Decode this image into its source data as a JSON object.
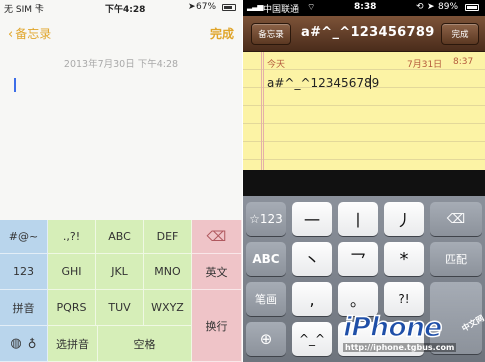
{
  "left": {
    "status": {
      "carrier": "无 SIM 卡",
      "time": "下午4:28",
      "battery": "67%"
    },
    "nav": {
      "back_label": "备忘录",
      "done_label": "完成"
    },
    "note": {
      "date": "2013年7月30日 下午4:28",
      "text": ""
    },
    "keyboard": {
      "col1": [
        "#@~",
        "123",
        "拼音"
      ],
      "col2": [
        ".,?!",
        "GHI",
        "PQRS"
      ],
      "col3": [
        "ABC",
        "JKL",
        "TUV"
      ],
      "col4": [
        "DEF",
        "MNO",
        "WXYZ"
      ],
      "col5": [
        "⌫",
        "英文",
        "换行"
      ],
      "bottom": {
        "select_pinyin": "选拼音",
        "space": "空格"
      }
    },
    "colors": {
      "accent": "#e0a52a",
      "key_blue": "#b9d5ec",
      "key_green": "#d6eeb8",
      "key_red": "#efc4c8"
    }
  },
  "right": {
    "status": {
      "carrier": "中国联通",
      "time": "8:38",
      "battery": "89%"
    },
    "nav": {
      "back_label": "备忘录",
      "title": "a#^_^123456789",
      "done_label": "完成"
    },
    "note": {
      "today": "今天",
      "date": "7月31日",
      "time": "8:37",
      "text": "a#^_^123456789"
    },
    "keyboard": {
      "row1": [
        "☆123",
        "一",
        "丨",
        "丿",
        "⌫"
      ],
      "row2": [
        "ABC",
        "丶",
        "乛",
        "*",
        "匹配"
      ],
      "row3": [
        "笔画",
        ",",
        "。",
        "?!",
        ""
      ],
      "row4": [
        "⊕",
        "^_^",
        "",
        "",
        ""
      ]
    }
  },
  "watermark": {
    "brand": "iPhone",
    "url": "http://iphone.tgbus.com",
    "tag": "中文网"
  }
}
